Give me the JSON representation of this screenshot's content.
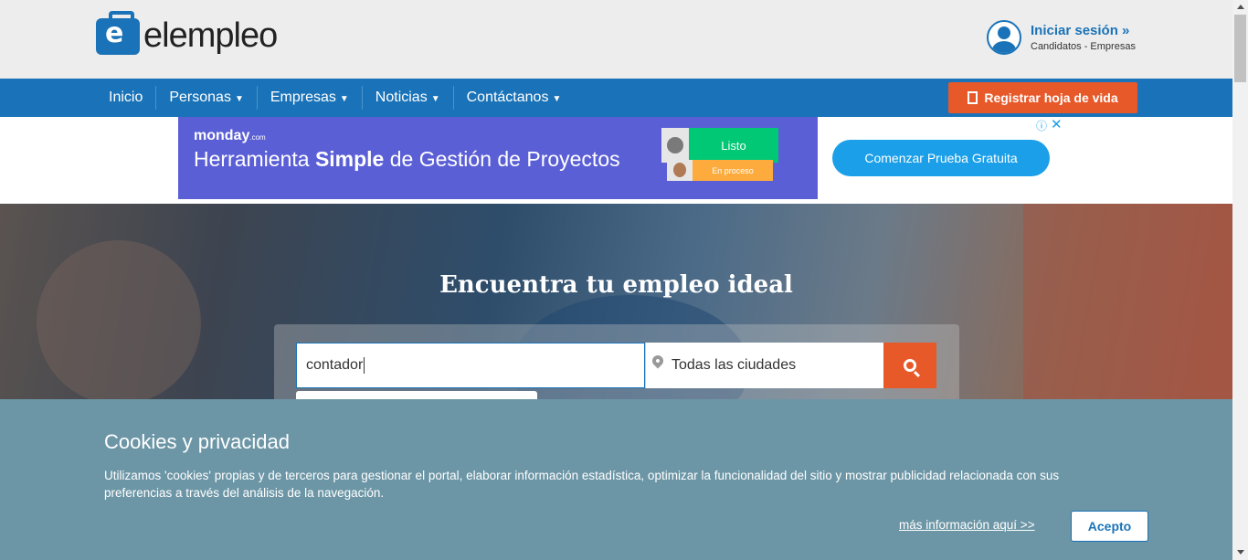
{
  "header": {
    "logo_text": "elempleo",
    "login_title": "Iniciar sesión »",
    "login_sub": "Candidatos - Empresas"
  },
  "nav": {
    "items": [
      "Inicio",
      "Personas",
      "Empresas",
      "Noticias",
      "Contáctanos"
    ],
    "register_label": "Registrar hoja de vida"
  },
  "ad": {
    "brand": "monday",
    "brand_suffix": ".com",
    "headline_pre": "Herramienta ",
    "headline_bold": "Simple",
    "headline_post": " de Gestión de Proyectos",
    "status_done": "Listo",
    "status_progress": "En proceso",
    "cta": "Comenzar Prueba Gratuita",
    "info": "ⓘ",
    "close": "✕"
  },
  "hero": {
    "title": "Encuentra tu empleo ideal",
    "search_value": "contador",
    "city_value": "Todas las ciudades"
  },
  "cookies": {
    "title": "Cookies y privacidad",
    "text": "Utilizamos 'cookies' propias y de terceros para gestionar el portal, elaborar información estadística, optimizar la funcionalidad del sitio y mostrar publicidad relacionada con sus preferencias a través del análisis de la navegación.",
    "more_link": "más información aquí >>",
    "accept": "Acepto"
  },
  "colors": {
    "brand_blue": "#1a73b8",
    "accent_orange": "#e8592a",
    "cookie_bg": "#6c96a6"
  }
}
